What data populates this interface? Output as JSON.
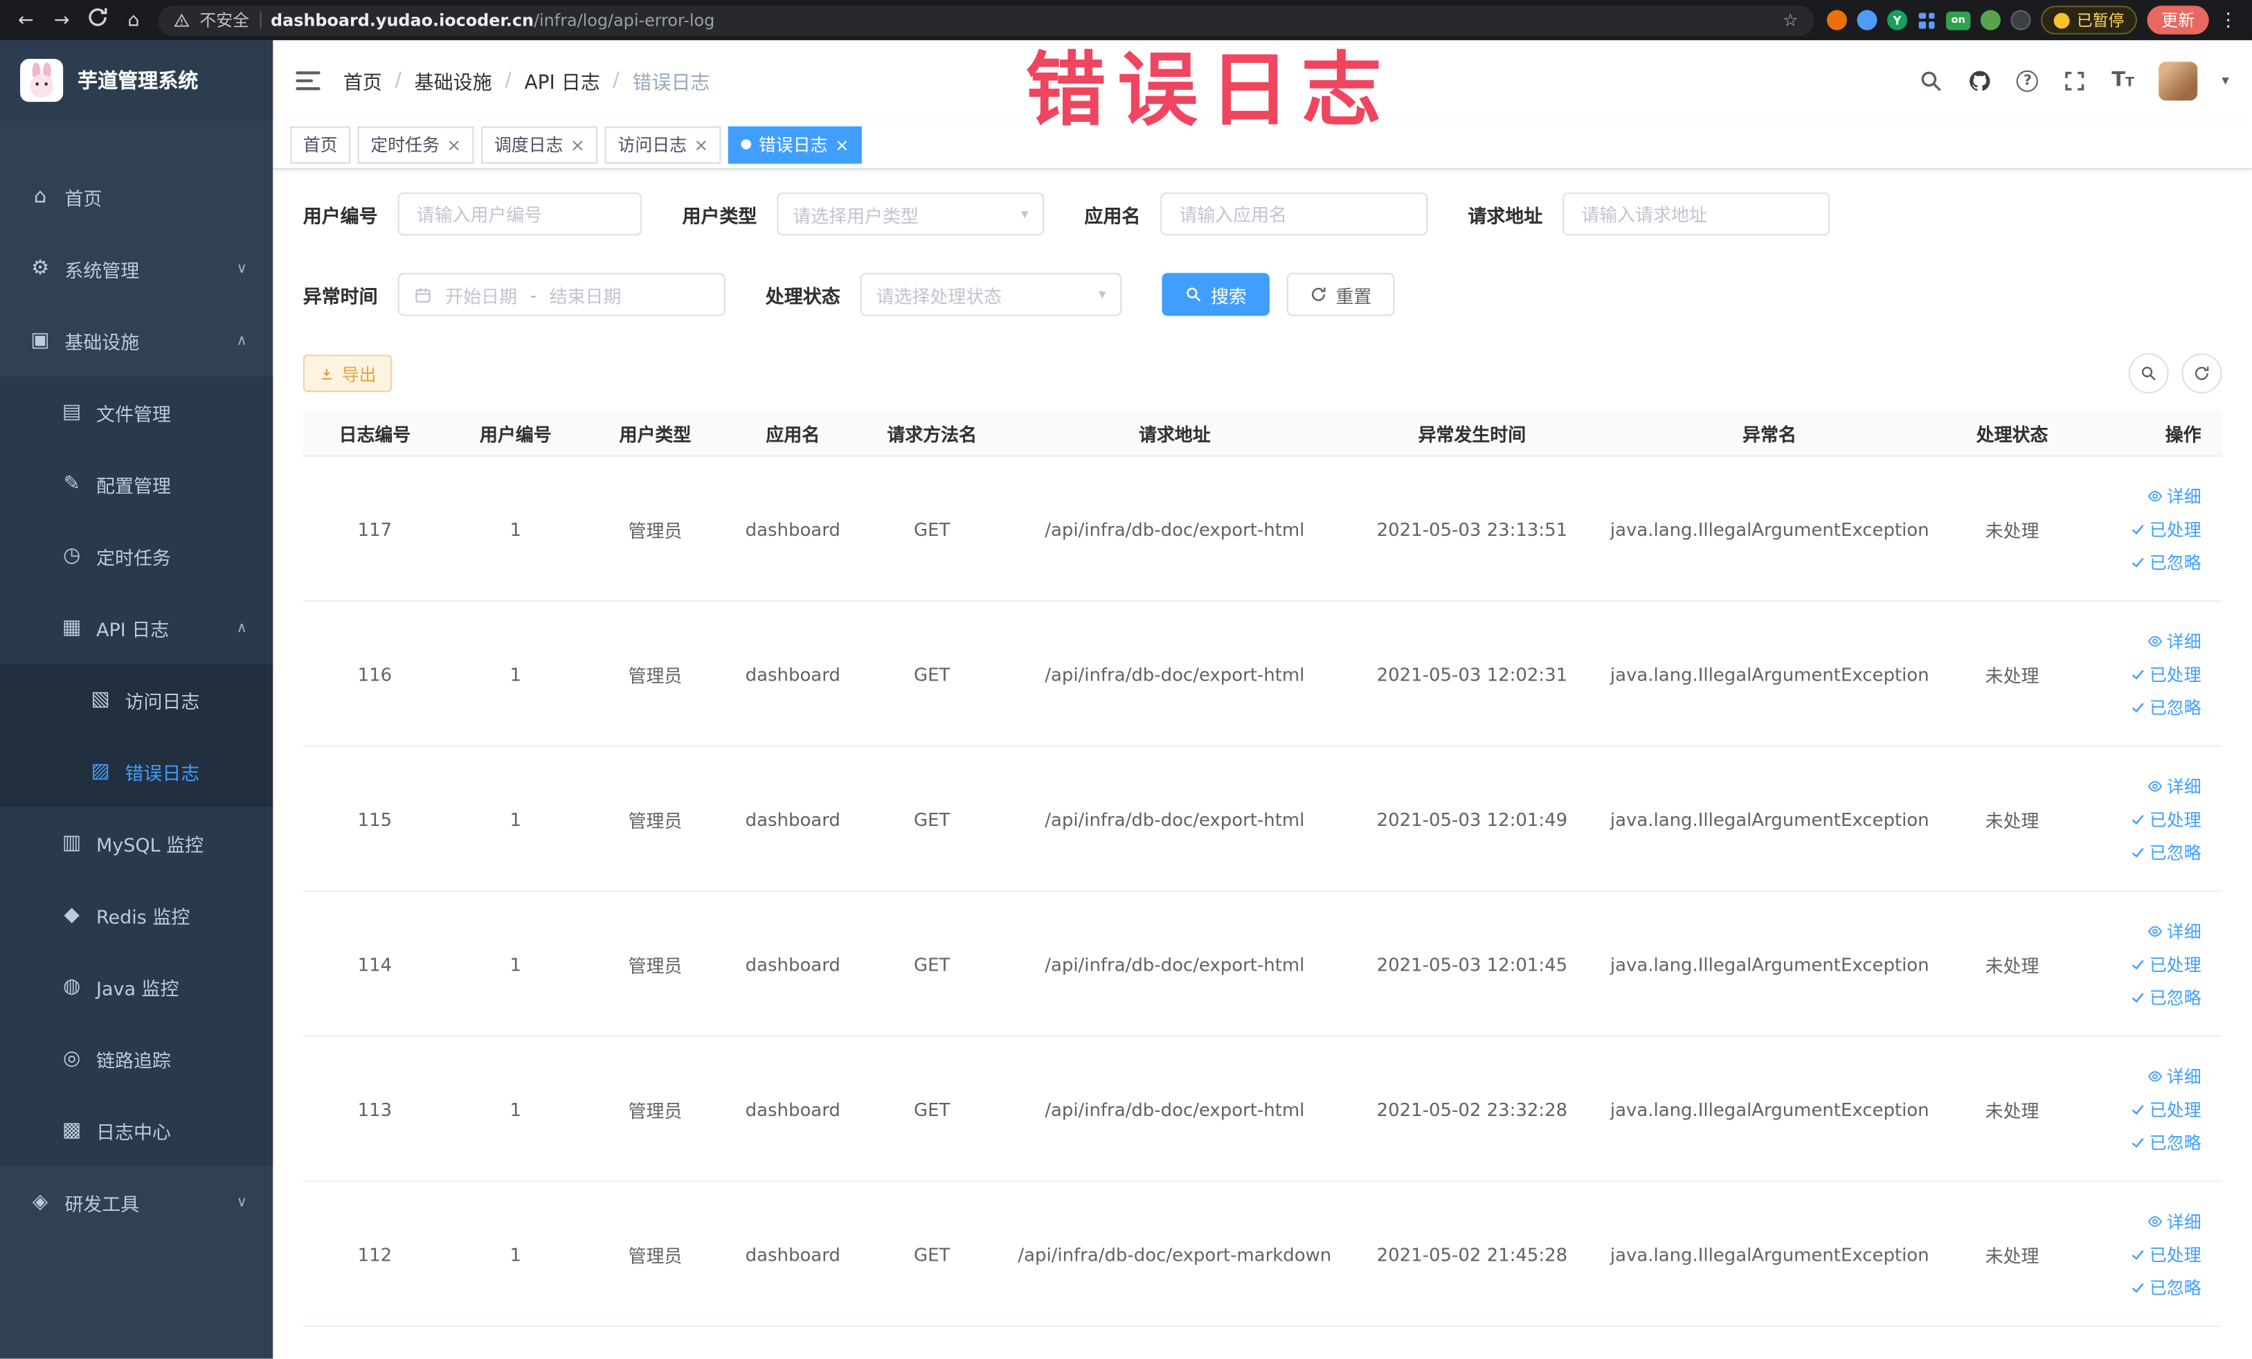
{
  "browser": {
    "security_label": "不安全",
    "url_host": "dashboard.yudao.iocoder.cn",
    "url_path": "/infra/log/api-error-log",
    "extension_on_badge": "on",
    "extension_y_badge": "Y",
    "paused_badge": "已暂停",
    "update_button": "更新"
  },
  "annotation": {
    "text": "错误日志"
  },
  "icons": {
    "back": "←",
    "forward": "→",
    "home_browser": "⌂",
    "star": "☆",
    "kebab": "⋮",
    "home": "⌂",
    "system": "⚙",
    "infrastructure": "▣",
    "file": "▤",
    "config": "✎",
    "timer": "◷",
    "api_log": "▦",
    "access_log": "▧",
    "error_log": "▨",
    "mysql": "▥",
    "redis": "◆",
    "java": "◍",
    "trace": "◎",
    "log_center": "▩",
    "devtools": "◈",
    "chevron_down": "∨",
    "chevron_up": "∧",
    "caret_down": "▾",
    "close": "×"
  },
  "sidebar": {
    "logo_title": "芋道管理系统",
    "items": [
      {
        "label": "首页"
      },
      {
        "label": "系统管理"
      },
      {
        "label": "基础设施"
      },
      {
        "label": "文件管理"
      },
      {
        "label": "配置管理"
      },
      {
        "label": "定时任务"
      },
      {
        "label": "API 日志"
      },
      {
        "label": "访问日志"
      },
      {
        "label": "错误日志"
      },
      {
        "label": "MySQL 监控"
      },
      {
        "label": "Redis 监控"
      },
      {
        "label": "Java 监控"
      },
      {
        "label": "链路追踪"
      },
      {
        "label": "日志中心"
      },
      {
        "label": "研发工具"
      }
    ]
  },
  "breadcrumb": {
    "separator": "/",
    "items": [
      "首页",
      "基础设施",
      "API 日志",
      "错误日志"
    ]
  },
  "tags": [
    {
      "label": "首页"
    },
    {
      "label": "定时任务"
    },
    {
      "label": "调度日志"
    },
    {
      "label": "访问日志"
    },
    {
      "label": "错误日志"
    }
  ],
  "filters": {
    "user_id_label": "用户编号",
    "user_id_placeholder": "请输入用户编号",
    "user_type_label": "用户类型",
    "user_type_placeholder": "请选择用户类型",
    "app_name_label": "应用名",
    "app_name_placeholder": "请输入应用名",
    "request_url_label": "请求地址",
    "request_url_placeholder": "请输入请求地址",
    "time_label": "异常时间",
    "time_start_placeholder": "开始日期",
    "time_separator": "-",
    "time_end_placeholder": "结束日期",
    "status_label": "处理状态",
    "status_placeholder": "请选择处理状态",
    "search_button": "搜索",
    "reset_button": "重置"
  },
  "toolbar": {
    "export_button": "导出"
  },
  "table": {
    "columns": [
      "日志编号",
      "用户编号",
      "用户类型",
      "应用名",
      "请求方法名",
      "请求地址",
      "异常发生时间",
      "异常名",
      "处理状态",
      "操作"
    ],
    "action_labels": [
      "详细",
      "已处理",
      "已忽略"
    ],
    "rows": [
      {
        "id": "117",
        "user_id": "1",
        "user_type": "管理员",
        "app": "dashboard",
        "method": "GET",
        "url": "/api/infra/db-doc/export-html",
        "time": "2021-05-03 23:13:51",
        "exception": "java.lang.IllegalArgumentException",
        "status": "未处理"
      },
      {
        "id": "116",
        "user_id": "1",
        "user_type": "管理员",
        "app": "dashboard",
        "method": "GET",
        "url": "/api/infra/db-doc/export-html",
        "time": "2021-05-03 12:02:31",
        "exception": "java.lang.IllegalArgumentException",
        "status": "未处理"
      },
      {
        "id": "115",
        "user_id": "1",
        "user_type": "管理员",
        "app": "dashboard",
        "method": "GET",
        "url": "/api/infra/db-doc/export-html",
        "time": "2021-05-03 12:01:49",
        "exception": "java.lang.IllegalArgumentException",
        "status": "未处理"
      },
      {
        "id": "114",
        "user_id": "1",
        "user_type": "管理员",
        "app": "dashboard",
        "method": "GET",
        "url": "/api/infra/db-doc/export-html",
        "time": "2021-05-03 12:01:45",
        "exception": "java.lang.IllegalArgumentException",
        "status": "未处理"
      },
      {
        "id": "113",
        "user_id": "1",
        "user_type": "管理员",
        "app": "dashboard",
        "method": "GET",
        "url": "/api/infra/db-doc/export-html",
        "time": "2021-05-02 23:32:28",
        "exception": "java.lang.IllegalArgumentException",
        "status": "未处理"
      },
      {
        "id": "112",
        "user_id": "1",
        "user_type": "管理员",
        "app": "dashboard",
        "method": "GET",
        "url": "/api/infra/db-doc/export-markdown",
        "time": "2021-05-02 21:45:28",
        "exception": "java.lang.IllegalArgumentException",
        "status": "未处理"
      }
    ]
  }
}
